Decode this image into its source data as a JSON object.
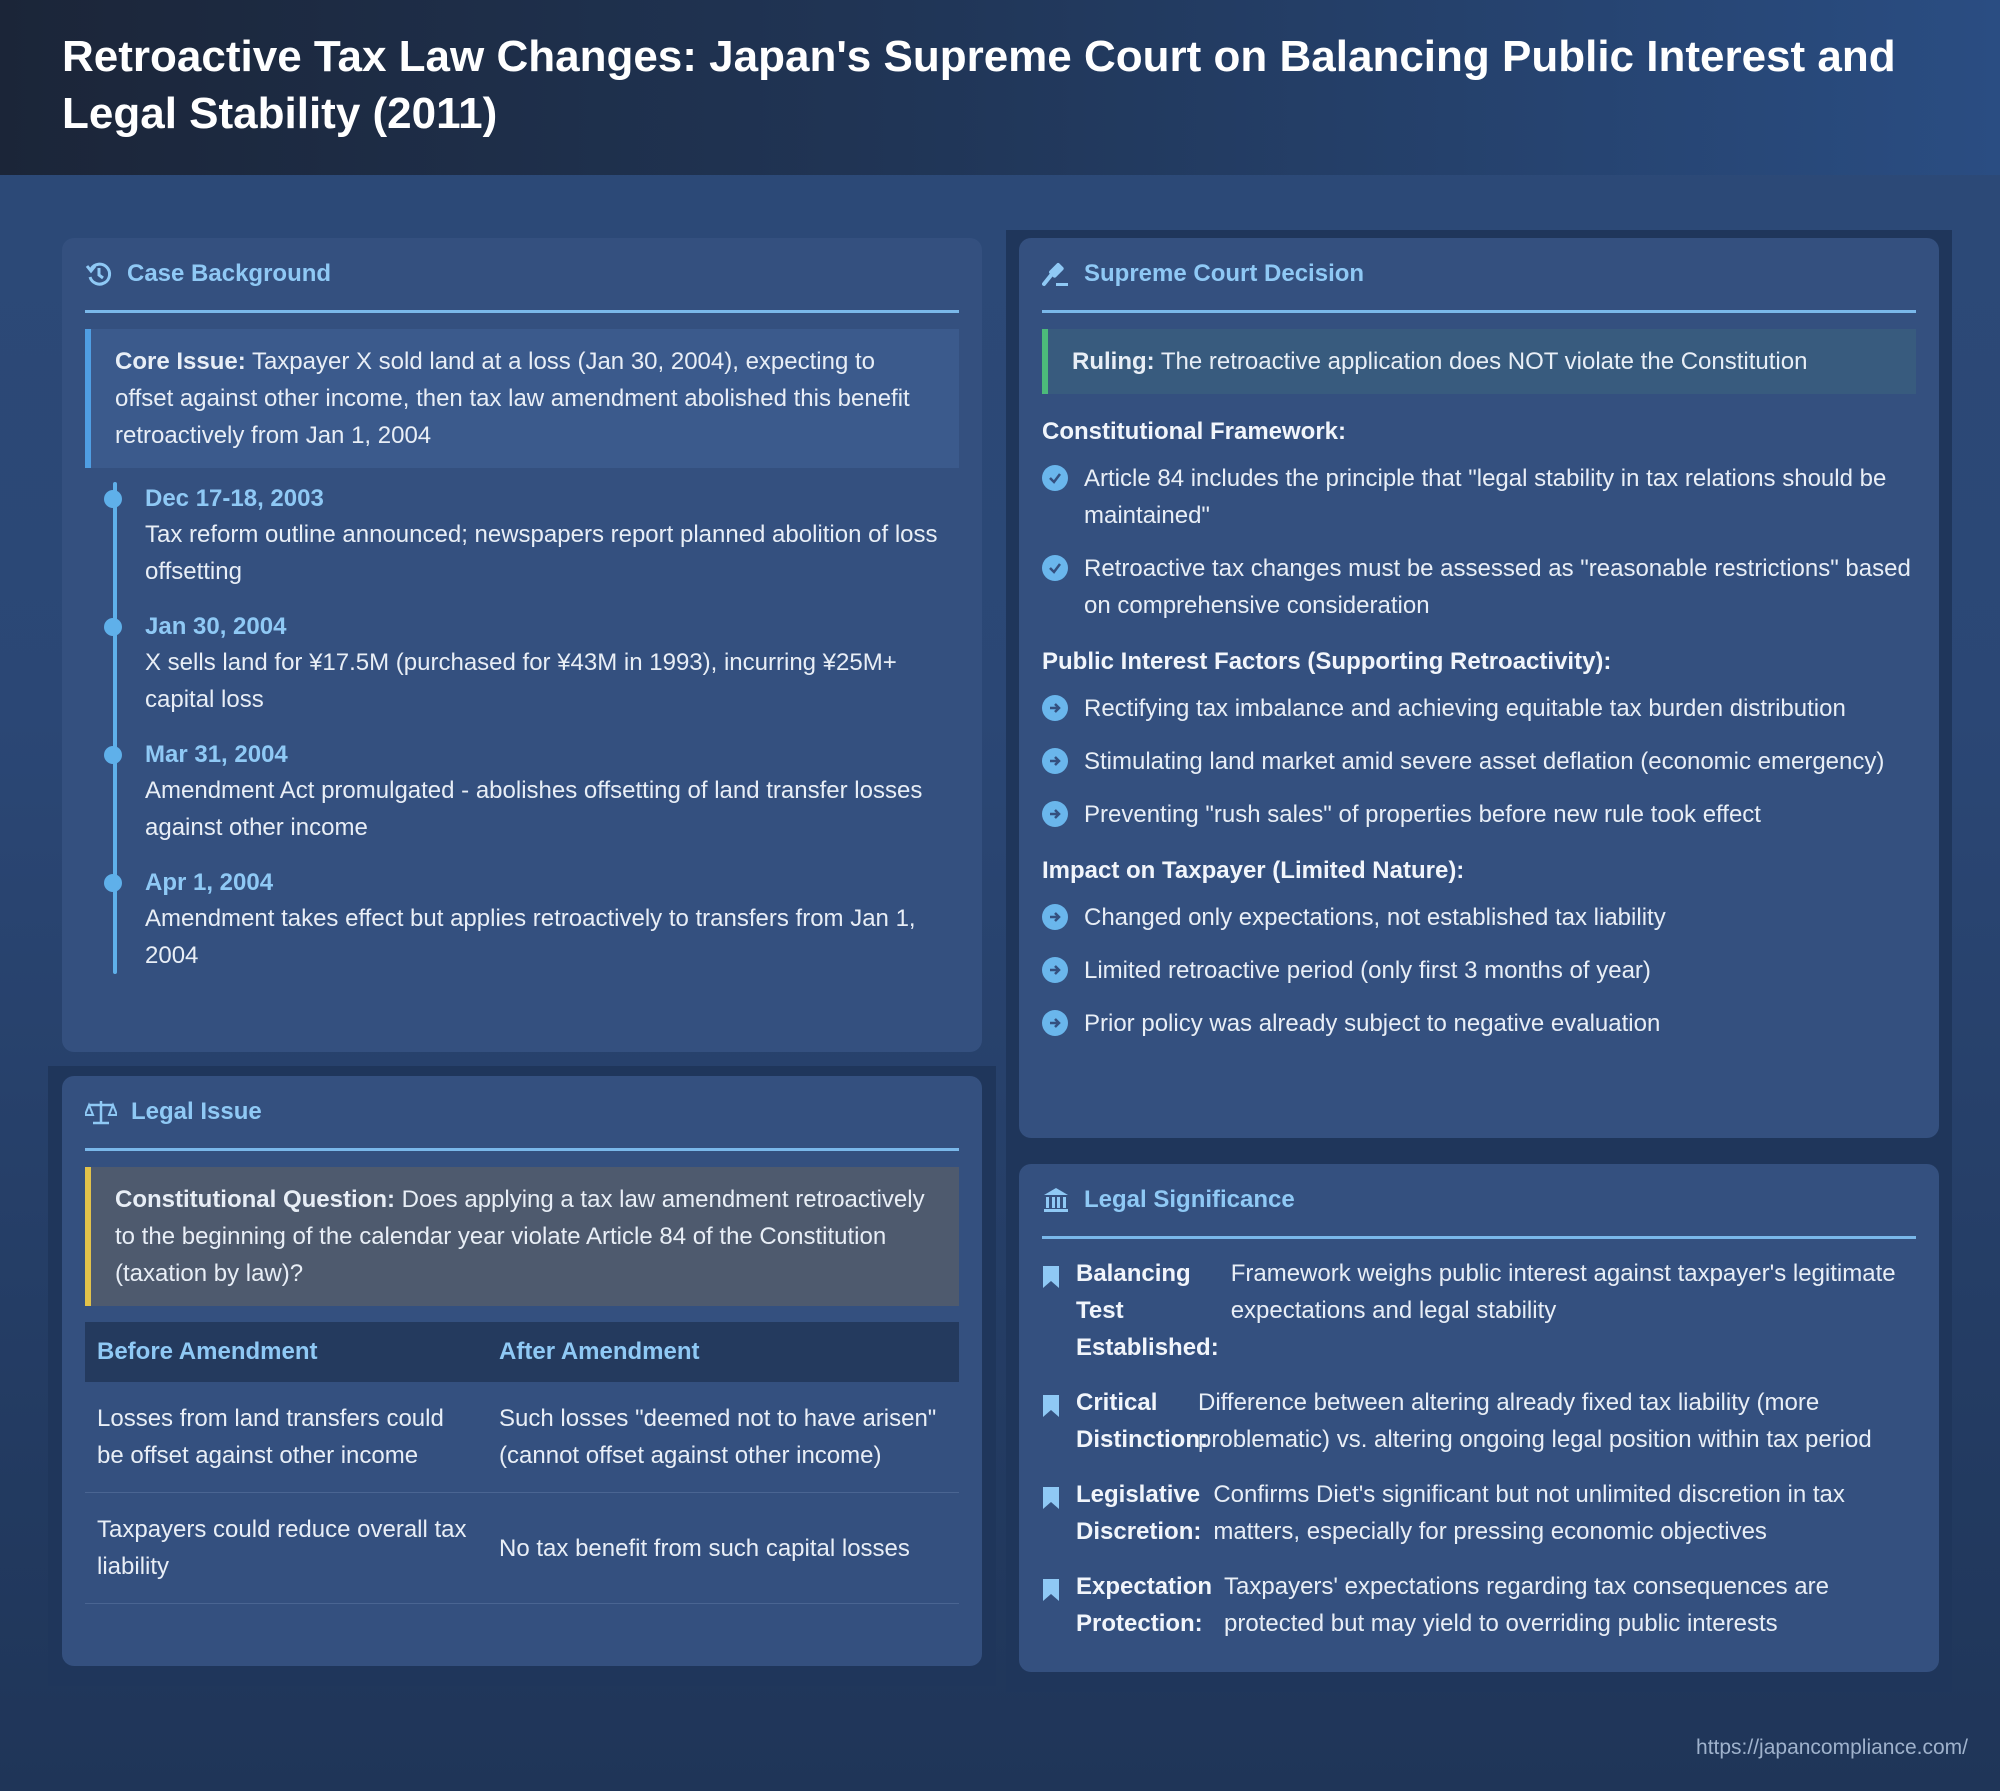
{
  "title": "Retroactive Tax Law Changes: Japan's Supreme Court on Balancing Public Interest and Legal Stability (2011)",
  "background": {
    "heading": "Case Background",
    "core_label": "Core Issue:",
    "core_text": " Taxpayer X sold land at a loss (Jan 30, 2004), expecting to offset against other income, then tax law amendment abolished this benefit retroactively from Jan 1, 2004",
    "timeline": [
      {
        "date": "Dec 17-18, 2003",
        "text": "Tax reform outline announced; newspapers report planned abolition of loss offsetting"
      },
      {
        "date": "Jan 30, 2004",
        "text": "X sells land for ¥17.5M (purchased for ¥43M in 1993), incurring ¥25M+ capital loss"
      },
      {
        "date": "Mar 31, 2004",
        "text": "Amendment Act promulgated - abolishes offsetting of land transfer losses against other income"
      },
      {
        "date": "Apr 1, 2004",
        "text": "Amendment takes effect but applies retroactively to transfers from Jan 1, 2004"
      }
    ]
  },
  "legal_issue": {
    "heading": "Legal Issue",
    "question_label": "Constitutional Question:",
    "question_text": " Does applying a tax law amendment retroactively to the beginning of the calendar year violate Article 84 of the Constitution (taxation by law)?",
    "columns": [
      "Before Amendment",
      "After Amendment"
    ],
    "rows": [
      [
        "Losses from land transfers could be offset against other income",
        "Such losses \"deemed not to have arisen\" (cannot offset against other income)"
      ],
      [
        "Taxpayers could reduce overall tax liability",
        "No tax benefit from such capital losses"
      ]
    ]
  },
  "decision": {
    "heading": "Supreme Court Decision",
    "ruling_label": "Ruling:",
    "ruling_text": " The retroactive application does NOT violate the Constitution",
    "framework_heading": "Constitutional Framework:",
    "framework": [
      "Article 84 includes the principle that \"legal stability in tax relations should be maintained\"",
      "Retroactive tax changes must be assessed as \"reasonable restrictions\" based on comprehensive consideration"
    ],
    "public_heading": "Public Interest Factors (Supporting Retroactivity):",
    "public": [
      "Rectifying tax imbalance and achieving equitable tax burden distribution",
      "Stimulating land market amid severe asset deflation (economic emergency)",
      "Preventing \"rush sales\" of properties before new rule took effect"
    ],
    "impact_heading": "Impact on Taxpayer (Limited Nature):",
    "impact": [
      "Changed only expectations, not established tax liability",
      "Limited retroactive period (only first 3 months of year)",
      "Prior policy was already subject to negative evaluation"
    ]
  },
  "significance": {
    "heading": "Legal Significance",
    "items": [
      {
        "label": "Balancing Test Established:",
        "text": "Framework weighs public interest against taxpayer's legitimate expectations and legal stability"
      },
      {
        "label": "Critical Distinction:",
        "text": "Difference between altering already fixed tax liability (more problematic) vs. altering ongoing legal position within tax period"
      },
      {
        "label": "Legislative Discretion:",
        "text": "Confirms Diet's significant but not unlimited discretion in tax matters, especially for pressing economic objectives"
      },
      {
        "label": "Expectation Protection:",
        "text": "Taxpayers' expectations regarding tax consequences are protected but may yield to overriding public interests"
      }
    ]
  },
  "footer": "https://japancompliance.com/",
  "colors": {
    "accent": "#8fc9f5",
    "card": "#34507f",
    "green": "#4cba7a",
    "yellow": "#e2c24a",
    "blue": "#4f9ee3"
  }
}
